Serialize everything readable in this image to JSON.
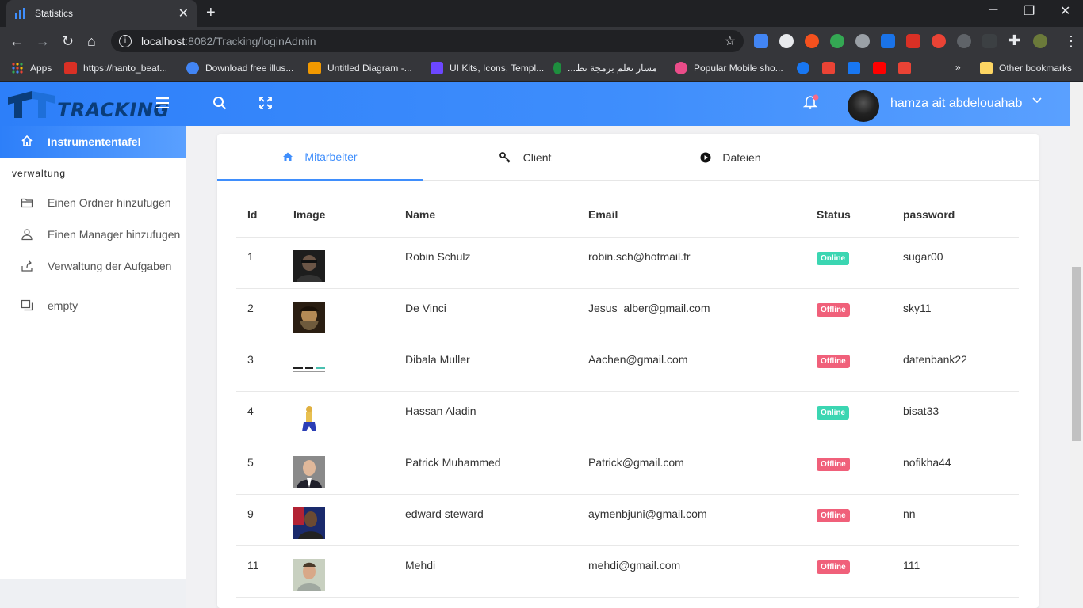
{
  "browser": {
    "tab_title": "Statistics",
    "tab_close": "✕",
    "new_tab": "+",
    "url_host": "localhost",
    "url_path": ":8082/Tracking/loginAdmin",
    "bookmarks": [
      {
        "label": "Apps",
        "color": "#ea4335"
      },
      {
        "label": "https://hanto_beat...",
        "color": "#d93025"
      },
      {
        "label": "Download free illus...",
        "color": "#4285f4"
      },
      {
        "label": "Untitled Diagram -...",
        "color": "#f29900"
      },
      {
        "label": "UI Kits, Icons, Templ...",
        "color": "#6c47ff"
      },
      {
        "label": "مسار تعلم برمجة تط...",
        "color": "#1e8e3e"
      },
      {
        "label": "Popular Mobile sho...",
        "color": "#ea4c89"
      }
    ],
    "other_bookmarks": "Other bookmarks",
    "overflow": "»"
  },
  "header": {
    "logo_text": "TRACKING",
    "user_name": "hamza ait abdelouahab"
  },
  "sidebar": {
    "active_item": "Instrumententafel",
    "section_heading": "verwaltung",
    "items": [
      {
        "label": "Einen Ordner hinzufugen"
      },
      {
        "label": "Einen Manager hinzufugen"
      },
      {
        "label": "Verwaltung der Aufgaben"
      },
      {
        "label": "empty"
      }
    ]
  },
  "tabs": [
    {
      "label": "Mitarbeiter",
      "icon": "home-icon",
      "active": true
    },
    {
      "label": "Client",
      "icon": "key-icon",
      "active": false
    },
    {
      "label": "Dateien",
      "icon": "play-circle-icon",
      "active": false
    }
  ],
  "table": {
    "headers": [
      "Id",
      "Image",
      "Name",
      "Email",
      "Status",
      "password"
    ],
    "rows": [
      {
        "id": "1",
        "name": "Robin Schulz",
        "email": "robin.sch@hotmail.fr",
        "status": "Online",
        "password": "sugar00",
        "image": "photo-dark"
      },
      {
        "id": "2",
        "name": "De Vinci",
        "email": "Jesus_alber@gmail.com",
        "status": "Offline",
        "password": "sky11",
        "image": "photo-portrait"
      },
      {
        "id": "3",
        "name": "Dibala Muller",
        "email": "Aachen@gmail.com",
        "status": "Offline",
        "password": "datenbank22",
        "image": "logo-strip"
      },
      {
        "id": "4",
        "name": "Hassan Aladin",
        "email": "",
        "status": "Online",
        "password": "bisat33",
        "image": "cartoon-figure"
      },
      {
        "id": "5",
        "name": "Patrick Muhammed",
        "email": "Patrick@gmail.com",
        "status": "Offline",
        "password": "nofikha44",
        "image": "photo-suit"
      },
      {
        "id": "9",
        "name": "edward steward",
        "email": "aymenbjuni@gmail.com",
        "status": "Offline",
        "password": "nn",
        "image": "photo-flag"
      },
      {
        "id": "11",
        "name": "Mehdi",
        "email": "mehdi@gmail.com",
        "status": "Offline",
        "password": "111",
        "image": "photo-young"
      }
    ]
  },
  "colors": {
    "accent": "#3f8efc",
    "online": "#3bd6b2",
    "offline": "#f0607a"
  }
}
